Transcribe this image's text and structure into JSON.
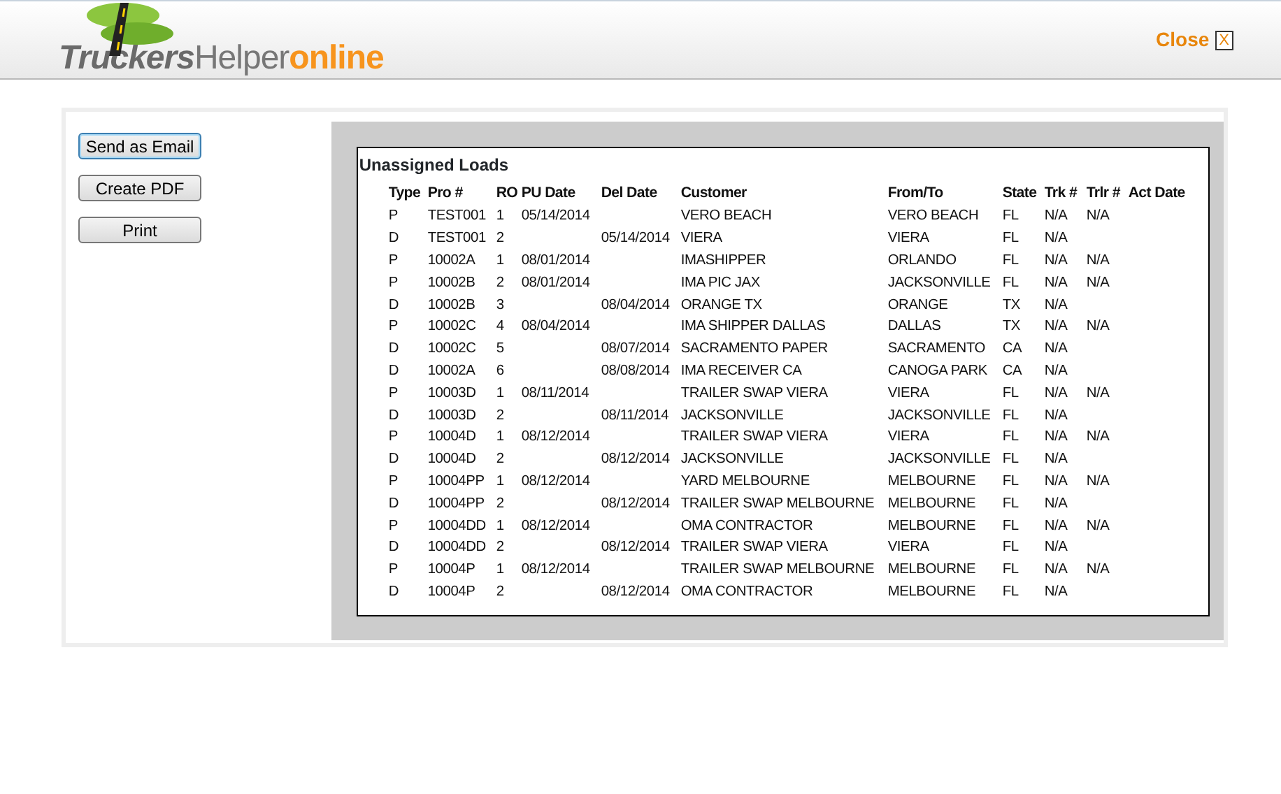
{
  "header": {
    "logo": {
      "part_1": "Truckers",
      "part_2": "Helper",
      "part_3": "online"
    },
    "close_label": "Close",
    "close_key": "X"
  },
  "actions": [
    "Send as Email",
    "Create PDF",
    "Print"
  ],
  "report": {
    "title": "Unassigned Loads",
    "columns": [
      "Type",
      "Pro #",
      "RO",
      "PU Date",
      "Del Date",
      "Customer",
      "From/To",
      "State",
      "Trk #",
      "Trlr #",
      "Act Date"
    ],
    "rows": [
      {
        "type": "P",
        "pro": "TEST001",
        "ro": "1",
        "pu_date": "05/14/2014",
        "customer": "VERO BEACH",
        "from_to": "VERO BEACH",
        "state": "FL",
        "trk": "N/A",
        "trlr": "N/A"
      },
      {
        "type": "D",
        "pro": "TEST001",
        "ro": "2",
        "del_date": "05/14/2014",
        "customer": "VIERA",
        "from_to": "VIERA",
        "state": "FL",
        "trk": "N/A"
      },
      {
        "type": "P",
        "pro": "10002A",
        "ro": "1",
        "pu_date": "08/01/2014",
        "customer": "IMASHIPPER",
        "from_to": "ORLANDO",
        "state": "FL",
        "trk": "N/A",
        "trlr": "N/A"
      },
      {
        "type": "P",
        "pro": "10002B",
        "ro": "2",
        "pu_date": "08/01/2014",
        "customer": "IMA PIC JAX",
        "from_to": "JACKSONVILLE",
        "state": "FL",
        "trk": "N/A",
        "trlr": "N/A"
      },
      {
        "type": "D",
        "pro": "10002B",
        "ro": "3",
        "del_date": "08/04/2014",
        "customer": "ORANGE TX",
        "from_to": "ORANGE",
        "state": "TX",
        "trk": "N/A"
      },
      {
        "type": "P",
        "pro": "10002C",
        "ro": "4",
        "pu_date": "08/04/2014",
        "customer": "IMA SHIPPER DALLAS",
        "from_to": "DALLAS",
        "state": "TX",
        "trk": "N/A",
        "trlr": "N/A"
      },
      {
        "type": "D",
        "pro": "10002C",
        "ro": "5",
        "del_date": "08/07/2014",
        "customer": "SACRAMENTO PAPER",
        "from_to": "SACRAMENTO",
        "state": "CA",
        "trk": "N/A"
      },
      {
        "type": "D",
        "pro": "10002A",
        "ro": "6",
        "del_date": "08/08/2014",
        "customer": "IMA RECEIVER CA",
        "from_to": "CANOGA PARK",
        "state": "CA",
        "trk": "N/A"
      },
      {
        "type": "P",
        "pro": "10003D",
        "ro": "1",
        "pu_date": "08/11/2014",
        "customer": "TRAILER SWAP VIERA",
        "from_to": "VIERA",
        "state": "FL",
        "trk": "N/A",
        "trlr": "N/A"
      },
      {
        "type": "D",
        "pro": "10003D",
        "ro": "2",
        "del_date": "08/11/2014",
        "customer": "JACKSONVILLE",
        "from_to": "JACKSONVILLE",
        "state": "FL",
        "trk": "N/A"
      },
      {
        "type": "P",
        "pro": "10004D",
        "ro": "1",
        "pu_date": "08/12/2014",
        "customer": "TRAILER SWAP VIERA",
        "from_to": "VIERA",
        "state": "FL",
        "trk": "N/A",
        "trlr": "N/A"
      },
      {
        "type": "D",
        "pro": "10004D",
        "ro": "2",
        "del_date": "08/12/2014",
        "customer": "JACKSONVILLE",
        "from_to": "JACKSONVILLE",
        "state": "FL",
        "trk": "N/A"
      },
      {
        "type": "P",
        "pro": "10004PP",
        "ro": "1",
        "pu_date": "08/12/2014",
        "customer": "YARD MELBOURNE",
        "from_to": "MELBOURNE",
        "state": "FL",
        "trk": "N/A",
        "trlr": "N/A"
      },
      {
        "type": "D",
        "pro": "10004PP",
        "ro": "2",
        "del_date": "08/12/2014",
        "customer": "TRAILER SWAP MELBOURNE",
        "from_to": "MELBOURNE",
        "state": "FL",
        "trk": "N/A"
      },
      {
        "type": "P",
        "pro": "10004DD",
        "ro": "1",
        "pu_date": "08/12/2014",
        "customer": "OMA CONTRACTOR",
        "from_to": "MELBOURNE",
        "state": "FL",
        "trk": "N/A",
        "trlr": "N/A"
      },
      {
        "type": "D",
        "pro": "10004DD",
        "ro": "2",
        "del_date": "08/12/2014",
        "customer": "TRAILER SWAP VIERA",
        "from_to": "VIERA",
        "state": "FL",
        "trk": "N/A"
      },
      {
        "type": "P",
        "pro": "10004P",
        "ro": "1",
        "pu_date": "08/12/2014",
        "customer": "TRAILER SWAP MELBOURNE",
        "from_to": "MELBOURNE",
        "state": "FL",
        "trk": "N/A",
        "trlr": "N/A"
      },
      {
        "type": "D",
        "pro": "10004P",
        "ro": "2",
        "del_date": "08/12/2014",
        "customer": "OMA CONTRACTOR",
        "from_to": "MELBOURNE",
        "state": "FL",
        "trk": "N/A"
      }
    ]
  }
}
